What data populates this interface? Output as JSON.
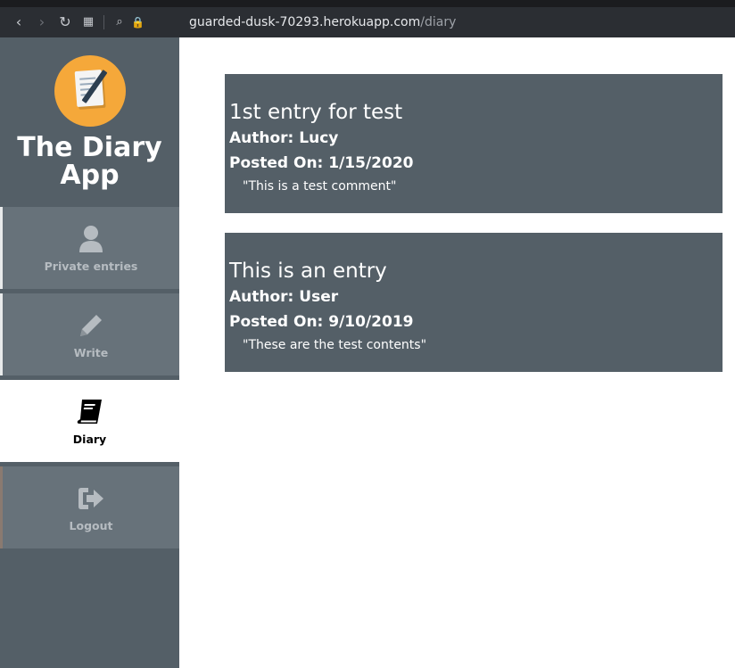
{
  "browser": {
    "url_host": "guarded-dusk-70293.herokuapp.com",
    "url_path": "/diary"
  },
  "sidebar": {
    "app_title_line1": "The Diary",
    "app_title_line2": "App",
    "items": [
      {
        "label": "Private entries",
        "icon": "user-icon"
      },
      {
        "label": "Write",
        "icon": "pencil-icon"
      },
      {
        "label": "Diary",
        "icon": "book-icon",
        "active": true
      },
      {
        "label": "Logout",
        "icon": "sign-out-icon"
      }
    ]
  },
  "entries": [
    {
      "title": "1st entry for test",
      "author": "Author: Lucy",
      "posted": "Posted On: 1/15/2020",
      "comment": "\"This is a test comment\""
    },
    {
      "title": "This is an entry",
      "author": "Author: User",
      "posted": "Posted On: 9/10/2019",
      "comment": "\"These are the test contents\""
    }
  ],
  "colors": {
    "sidebar_bg": "#545f67",
    "nav_item_bg": "#67727a",
    "entry_bg": "#545f67",
    "logo_bg": "#f5a83a"
  }
}
